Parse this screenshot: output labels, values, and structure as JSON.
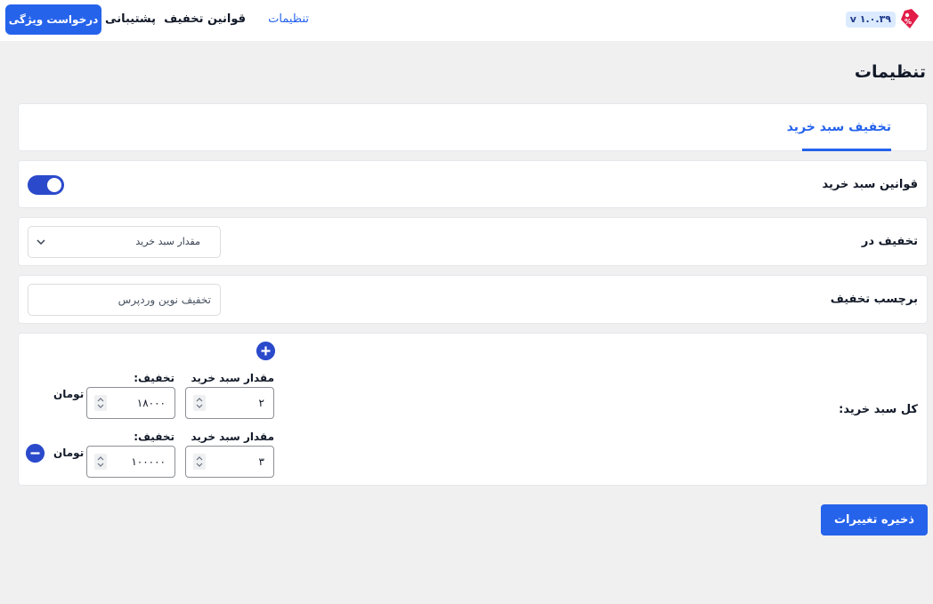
{
  "header": {
    "version": "v ۱.۰.۳۹",
    "nav": {
      "settings": "تنظیمات",
      "discount_rules": "قوانین تخفیف",
      "support": "پشتیبانی"
    },
    "feature_request": "درخواست ویژگی"
  },
  "page": {
    "title": "تنظیمات",
    "active_tab": "تخفیف سبد خرید"
  },
  "cart_rules": {
    "label": "قوانین سبد خرید",
    "enabled": true
  },
  "discount_in": {
    "label": "تخفیف در",
    "selected": "مقدار سبد خرید"
  },
  "discount_label": {
    "label": "برچسب تخفیف",
    "placeholder": "تخفیف نوین وردپرس"
  },
  "cart_total": {
    "label": "کل سبد خرید:",
    "rows": [
      {
        "qty_label": "مقدار سبد خرید",
        "qty": "۲",
        "discount_label": "تخفیف:",
        "discount": "۱۸۰۰۰",
        "unit": "تومان"
      },
      {
        "qty_label": "مقدار سبد خرید",
        "qty": "۳",
        "discount_label": "تخفیف:",
        "discount": "۱۰۰۰۰۰",
        "unit": "تومان"
      }
    ]
  },
  "save_button": "ذخیره تغییرات",
  "colors": {
    "accent": "#2563eb",
    "toggle": "#2b4acb",
    "background": "#f0f0f1"
  },
  "icons": [
    "discount-logo-icon",
    "chevron-down-icon",
    "plus-circle-icon",
    "minus-circle-icon",
    "spinner-arrows-icon"
  ]
}
